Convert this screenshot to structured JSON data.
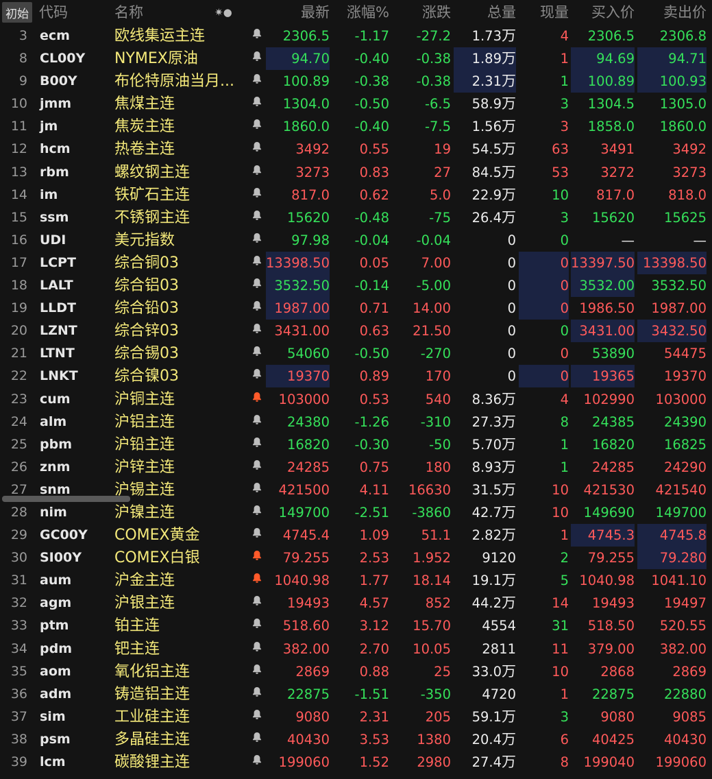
{
  "header": {
    "reset_label": "初始",
    "columns": {
      "code": "代码",
      "name": "名称",
      "tools": "✷●",
      "last": "最新",
      "pct": "涨幅%",
      "chg": "涨跌",
      "vol": "总量",
      "cur": "现量",
      "bid": "买入价",
      "ask": "卖出价"
    }
  },
  "colors": {
    "up": "#ff5a5a",
    "down": "#35e05a",
    "name": "#f4e97a",
    "highlight": "#1b2342",
    "alert_bell": "#ff5a2a"
  },
  "rows": [
    {
      "idx": "3",
      "code": "ecm",
      "name": "欧线集运主连",
      "bell": "bell-icon",
      "last": "2306.5",
      "pct": "-1.17",
      "chg": "-27.2",
      "vol": "1.73",
      "unit": "万",
      "cur": "4",
      "bid": "2306.5",
      "ask": "2306.8",
      "dir": "dn",
      "cur_dir": "up",
      "bid_dir": "dn",
      "ask_dir": "dn",
      "hl": []
    },
    {
      "idx": "8",
      "code": "CL00Y",
      "name": "NYMEX原油",
      "bell": "bell-icon",
      "last": "94.70",
      "pct": "-0.40",
      "chg": "-0.38",
      "vol": "1.89",
      "unit": "万",
      "cur": "1",
      "bid": "94.69",
      "ask": "94.71",
      "dir": "dn",
      "cur_dir": "up",
      "bid_dir": "dn",
      "ask_dir": "dn",
      "hl": [
        "last",
        "vol",
        "bid",
        "ask"
      ]
    },
    {
      "idx": "9",
      "code": "B00Y",
      "name": "布伦特原油当月...",
      "bell": "bell-icon",
      "last": "100.89",
      "pct": "-0.38",
      "chg": "-0.38",
      "vol": "2.31",
      "unit": "万",
      "cur": "1",
      "bid": "100.89",
      "ask": "100.93",
      "dir": "dn",
      "cur_dir": "dn",
      "bid_dir": "dn",
      "ask_dir": "dn",
      "hl": [
        "vol",
        "bid",
        "ask"
      ]
    },
    {
      "idx": "10",
      "code": "jmm",
      "name": "焦煤主连",
      "bell": "bell-icon",
      "last": "1304.0",
      "pct": "-0.50",
      "chg": "-6.5",
      "vol": "58.9",
      "unit": "万",
      "cur": "3",
      "bid": "1304.5",
      "ask": "1305.0",
      "dir": "dn",
      "cur_dir": "dn",
      "bid_dir": "dn",
      "ask_dir": "dn",
      "hl": []
    },
    {
      "idx": "11",
      "code": "jm",
      "name": "焦炭主连",
      "bell": "bell-icon",
      "last": "1860.0",
      "pct": "-0.40",
      "chg": "-7.5",
      "vol": "1.56",
      "unit": "万",
      "cur": "3",
      "bid": "1858.0",
      "ask": "1860.0",
      "dir": "dn",
      "cur_dir": "up",
      "bid_dir": "dn",
      "ask_dir": "dn",
      "hl": []
    },
    {
      "idx": "12",
      "code": "hcm",
      "name": "热卷主连",
      "bell": "bell-icon",
      "last": "3492",
      "pct": "0.55",
      "chg": "19",
      "vol": "54.5",
      "unit": "万",
      "cur": "63",
      "bid": "3491",
      "ask": "3492",
      "dir": "up",
      "cur_dir": "up",
      "bid_dir": "up",
      "ask_dir": "up",
      "hl": []
    },
    {
      "idx": "13",
      "code": "rbm",
      "name": "螺纹钢主连",
      "bell": "bell-icon",
      "last": "3273",
      "pct": "0.83",
      "chg": "27",
      "vol": "84.5",
      "unit": "万",
      "cur": "53",
      "bid": "3272",
      "ask": "3273",
      "dir": "up",
      "cur_dir": "up",
      "bid_dir": "up",
      "ask_dir": "up",
      "hl": []
    },
    {
      "idx": "14",
      "code": "im",
      "name": "铁矿石主连",
      "bell": "bell-icon",
      "last": "817.0",
      "pct": "0.62",
      "chg": "5.0",
      "vol": "22.9",
      "unit": "万",
      "cur": "10",
      "bid": "817.0",
      "ask": "818.0",
      "dir": "up",
      "cur_dir": "dn",
      "bid_dir": "up",
      "ask_dir": "up",
      "hl": []
    },
    {
      "idx": "15",
      "code": "ssm",
      "name": "不锈钢主连",
      "bell": "bell-icon",
      "last": "15620",
      "pct": "-0.48",
      "chg": "-75",
      "vol": "26.4",
      "unit": "万",
      "cur": "3",
      "bid": "15620",
      "ask": "15625",
      "dir": "dn",
      "cur_dir": "dn",
      "bid_dir": "dn",
      "ask_dir": "dn",
      "hl": []
    },
    {
      "idx": "16",
      "code": "UDI",
      "name": "美元指数",
      "bell": "bell-icon",
      "last": "97.98",
      "pct": "-0.04",
      "chg": "-0.04",
      "vol": "0",
      "unit": "",
      "cur": "0",
      "bid": "—",
      "ask": "—",
      "dir": "dn",
      "cur_dir": "dn",
      "bid_dir": "eq",
      "ask_dir": "eq",
      "hl": []
    },
    {
      "idx": "17",
      "code": "LCPT",
      "name": "综合铜03",
      "bell": "bell-icon",
      "last": "13398.50",
      "pct": "0.05",
      "chg": "7.00",
      "vol": "0",
      "unit": "",
      "cur": "0",
      "bid": "13397.50",
      "ask": "13398.50",
      "dir": "up",
      "cur_dir": "up",
      "bid_dir": "up",
      "ask_dir": "up",
      "hl": [
        "last",
        "cur",
        "bid",
        "ask"
      ]
    },
    {
      "idx": "18",
      "code": "LALT",
      "name": "综合铝03",
      "bell": "bell-icon",
      "last": "3532.50",
      "pct": "-0.14",
      "chg": "-5.00",
      "vol": "0",
      "unit": "",
      "cur": "0",
      "bid": "3532.00",
      "ask": "3532.50",
      "dir": "dn",
      "cur_dir": "up",
      "bid_dir": "dn",
      "ask_dir": "dn",
      "hl": [
        "last",
        "cur",
        "bid"
      ]
    },
    {
      "idx": "19",
      "code": "LLDT",
      "name": "综合铅03",
      "bell": "bell-icon",
      "last": "1987.00",
      "pct": "0.71",
      "chg": "14.00",
      "vol": "0",
      "unit": "",
      "cur": "0",
      "bid": "1986.50",
      "ask": "1987.00",
      "dir": "up",
      "cur_dir": "up",
      "bid_dir": "up",
      "ask_dir": "up",
      "hl": [
        "last",
        "cur"
      ]
    },
    {
      "idx": "20",
      "code": "LZNT",
      "name": "综合锌03",
      "bell": "bell-icon",
      "last": "3431.00",
      "pct": "0.63",
      "chg": "21.50",
      "vol": "0",
      "unit": "",
      "cur": "0",
      "bid": "3431.00",
      "ask": "3432.50",
      "dir": "up",
      "cur_dir": "dn",
      "bid_dir": "up",
      "ask_dir": "up",
      "hl": [
        "bid",
        "ask"
      ]
    },
    {
      "idx": "21",
      "code": "LTNT",
      "name": "综合锡03",
      "bell": "bell-icon",
      "last": "54060",
      "pct": "-0.50",
      "chg": "-270",
      "vol": "0",
      "unit": "",
      "cur": "0",
      "bid": "53890",
      "ask": "54475",
      "dir": "dn",
      "cur_dir": "up",
      "bid_dir": "dn",
      "ask_dir": "up",
      "hl": []
    },
    {
      "idx": "22",
      "code": "LNKT",
      "name": "综合镍03",
      "bell": "bell-icon",
      "last": "19370",
      "pct": "0.89",
      "chg": "170",
      "vol": "0",
      "unit": "",
      "cur": "0",
      "bid": "19365",
      "ask": "19370",
      "dir": "up",
      "cur_dir": "up",
      "bid_dir": "up",
      "ask_dir": "up",
      "hl": [
        "last",
        "cur",
        "bid"
      ]
    },
    {
      "idx": "23",
      "code": "cum",
      "name": "沪铜主连",
      "bell": "bell-active-icon",
      "last": "103000",
      "pct": "0.53",
      "chg": "540",
      "vol": "8.36",
      "unit": "万",
      "cur": "4",
      "bid": "102990",
      "ask": "103000",
      "dir": "up",
      "cur_dir": "up",
      "bid_dir": "up",
      "ask_dir": "up",
      "hl": []
    },
    {
      "idx": "24",
      "code": "alm",
      "name": "沪铝主连",
      "bell": "bell-icon",
      "last": "24380",
      "pct": "-1.26",
      "chg": "-310",
      "vol": "27.3",
      "unit": "万",
      "cur": "8",
      "bid": "24385",
      "ask": "24390",
      "dir": "dn",
      "cur_dir": "dn",
      "bid_dir": "dn",
      "ask_dir": "dn",
      "hl": []
    },
    {
      "idx": "25",
      "code": "pbm",
      "name": "沪铅主连",
      "bell": "bell-icon",
      "last": "16820",
      "pct": "-0.30",
      "chg": "-50",
      "vol": "5.70",
      "unit": "万",
      "cur": "1",
      "bid": "16820",
      "ask": "16825",
      "dir": "dn",
      "cur_dir": "dn",
      "bid_dir": "dn",
      "ask_dir": "dn",
      "hl": []
    },
    {
      "idx": "26",
      "code": "znm",
      "name": "沪锌主连",
      "bell": "bell-icon",
      "last": "24285",
      "pct": "0.75",
      "chg": "180",
      "vol": "8.93",
      "unit": "万",
      "cur": "1",
      "bid": "24285",
      "ask": "24290",
      "dir": "up",
      "cur_dir": "dn",
      "bid_dir": "up",
      "ask_dir": "up",
      "hl": []
    },
    {
      "idx": "27",
      "code": "snm",
      "name": "沪锡主连",
      "bell": "bell-icon",
      "last": "421500",
      "pct": "4.11",
      "chg": "16630",
      "vol": "31.5",
      "unit": "万",
      "cur": "10",
      "bid": "421530",
      "ask": "421540",
      "dir": "up",
      "cur_dir": "up",
      "bid_dir": "up",
      "ask_dir": "up",
      "hl": []
    },
    {
      "idx": "28",
      "code": "nim",
      "name": "沪镍主连",
      "bell": "bell-icon",
      "last": "149700",
      "pct": "-2.51",
      "chg": "-3860",
      "vol": "42.7",
      "unit": "万",
      "cur": "10",
      "bid": "149690",
      "ask": "149700",
      "dir": "dn",
      "cur_dir": "up",
      "bid_dir": "dn",
      "ask_dir": "dn",
      "hl": []
    },
    {
      "idx": "29",
      "code": "GC00Y",
      "name": "COMEX黄金",
      "bell": "bell-icon",
      "last": "4745.4",
      "pct": "1.09",
      "chg": "51.1",
      "vol": "2.82",
      "unit": "万",
      "cur": "1",
      "bid": "4745.3",
      "ask": "4745.8",
      "dir": "up",
      "cur_dir": "up",
      "bid_dir": "up",
      "ask_dir": "up",
      "hl": [
        "bid",
        "ask"
      ]
    },
    {
      "idx": "30",
      "code": "SI00Y",
      "name": "COMEX白银",
      "bell": "bell-active-icon",
      "last": "79.255",
      "pct": "2.53",
      "chg": "1.952",
      "vol": "9120",
      "unit": "",
      "cur": "2",
      "bid": "79.255",
      "ask": "79.280",
      "dir": "up",
      "cur_dir": "dn",
      "bid_dir": "up",
      "ask_dir": "up",
      "hl": [
        "ask"
      ]
    },
    {
      "idx": "31",
      "code": "aum",
      "name": "沪金主连",
      "bell": "bell-active-icon",
      "last": "1040.98",
      "pct": "1.77",
      "chg": "18.14",
      "vol": "19.1",
      "unit": "万",
      "cur": "5",
      "bid": "1040.98",
      "ask": "1041.10",
      "dir": "up",
      "cur_dir": "dn",
      "bid_dir": "up",
      "ask_dir": "up",
      "hl": []
    },
    {
      "idx": "32",
      "code": "agm",
      "name": "沪银主连",
      "bell": "bell-icon",
      "last": "19493",
      "pct": "4.57",
      "chg": "852",
      "vol": "44.2",
      "unit": "万",
      "cur": "14",
      "bid": "19493",
      "ask": "19497",
      "dir": "up",
      "cur_dir": "up",
      "bid_dir": "up",
      "ask_dir": "up",
      "hl": []
    },
    {
      "idx": "33",
      "code": "ptm",
      "name": "铂主连",
      "bell": "bell-icon",
      "last": "518.60",
      "pct": "3.12",
      "chg": "15.70",
      "vol": "4554",
      "unit": "",
      "cur": "31",
      "bid": "518.50",
      "ask": "520.55",
      "dir": "up",
      "cur_dir": "dn",
      "bid_dir": "up",
      "ask_dir": "up",
      "hl": []
    },
    {
      "idx": "34",
      "code": "pdm",
      "name": "钯主连",
      "bell": "bell-icon",
      "last": "382.00",
      "pct": "2.70",
      "chg": "10.05",
      "vol": "2811",
      "unit": "",
      "cur": "11",
      "bid": "379.00",
      "ask": "382.00",
      "dir": "up",
      "cur_dir": "up",
      "bid_dir": "up",
      "ask_dir": "up",
      "hl": []
    },
    {
      "idx": "35",
      "code": "aom",
      "name": "氧化铝主连",
      "bell": "bell-icon",
      "last": "2869",
      "pct": "0.88",
      "chg": "25",
      "vol": "33.0",
      "unit": "万",
      "cur": "10",
      "bid": "2868",
      "ask": "2869",
      "dir": "up",
      "cur_dir": "up",
      "bid_dir": "up",
      "ask_dir": "up",
      "hl": []
    },
    {
      "idx": "36",
      "code": "adm",
      "name": "铸造铝主连",
      "bell": "bell-icon",
      "last": "22875",
      "pct": "-1.51",
      "chg": "-350",
      "vol": "4720",
      "unit": "",
      "cur": "1",
      "bid": "22875",
      "ask": "22880",
      "dir": "dn",
      "cur_dir": "up",
      "bid_dir": "dn",
      "ask_dir": "dn",
      "hl": []
    },
    {
      "idx": "37",
      "code": "sim",
      "name": "工业硅主连",
      "bell": "bell-icon",
      "last": "9080",
      "pct": "2.31",
      "chg": "205",
      "vol": "59.1",
      "unit": "万",
      "cur": "3",
      "bid": "9080",
      "ask": "9085",
      "dir": "up",
      "cur_dir": "dn",
      "bid_dir": "up",
      "ask_dir": "up",
      "hl": []
    },
    {
      "idx": "38",
      "code": "psm",
      "name": "多晶硅主连",
      "bell": "bell-icon",
      "last": "40430",
      "pct": "3.53",
      "chg": "1380",
      "vol": "20.4",
      "unit": "万",
      "cur": "6",
      "bid": "40425",
      "ask": "40430",
      "dir": "up",
      "cur_dir": "up",
      "bid_dir": "up",
      "ask_dir": "up",
      "hl": []
    },
    {
      "idx": "39",
      "code": "lcm",
      "name": "碳酸锂主连",
      "bell": "bell-icon",
      "last": "199060",
      "pct": "1.52",
      "chg": "2980",
      "vol": "27.4",
      "unit": "万",
      "cur": "8",
      "bid": "199040",
      "ask": "199060",
      "dir": "up",
      "cur_dir": "up",
      "bid_dir": "up",
      "ask_dir": "up",
      "hl": []
    }
  ]
}
